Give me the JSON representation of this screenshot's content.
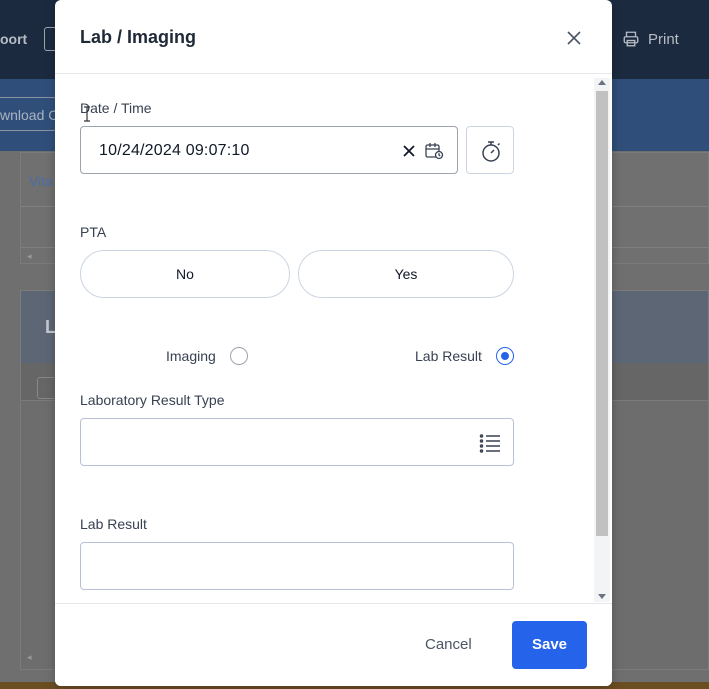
{
  "background": {
    "topbar_left_text": "oort",
    "print_label": "Print",
    "download_text": "wnload C",
    "tab_label": "Vita",
    "card_title": "L"
  },
  "modal": {
    "title": "Lab / Imaging",
    "close_icon": "close-icon",
    "date_time": {
      "label": "Date / Time",
      "value": "10/24/2024 09:07:10",
      "clear_icon": "clear-icon",
      "calendar_icon": "calendar-clock-icon",
      "timer_icon": "stopwatch-icon"
    },
    "pta": {
      "label": "PTA",
      "options": [
        "No",
        "Yes"
      ]
    },
    "result_kind": {
      "options": [
        {
          "label": "Imaging",
          "checked": false
        },
        {
          "label": "Lab Result",
          "checked": true
        }
      ]
    },
    "lab_result_type": {
      "label": "Laboratory Result Type",
      "value": "",
      "icon": "list-icon"
    },
    "lab_result": {
      "label": "Lab Result",
      "value": ""
    },
    "footer": {
      "cancel_label": "Cancel",
      "save_label": "Save"
    }
  },
  "colors": {
    "primary": "#2563eb",
    "overlay": "#6b6b6b",
    "header_dark": "#1c2a40"
  }
}
